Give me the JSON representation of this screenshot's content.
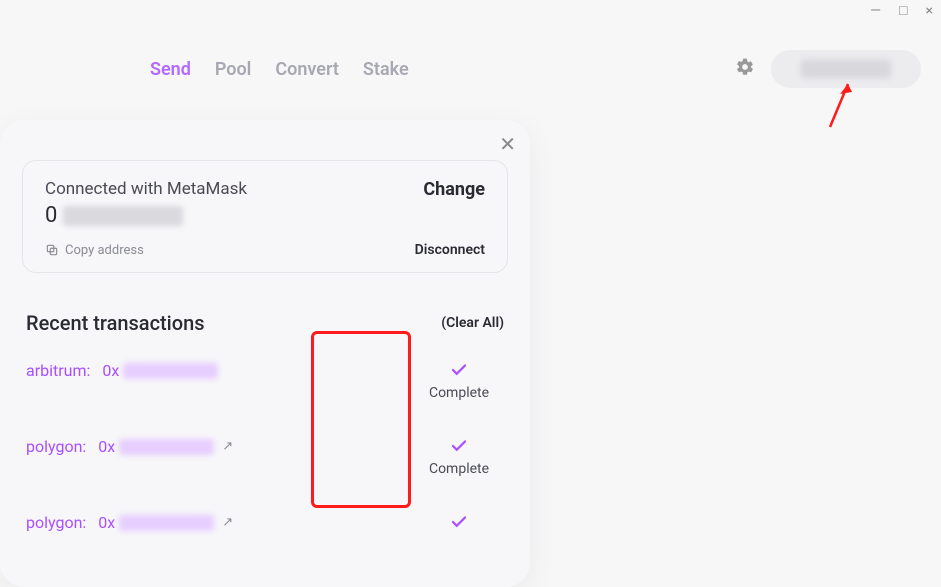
{
  "window": {
    "minimize": "—",
    "maximize": "□",
    "close": "×"
  },
  "nav": {
    "items": [
      {
        "label": "Send",
        "active": true
      },
      {
        "label": "Pool",
        "active": false
      },
      {
        "label": "Convert",
        "active": false
      },
      {
        "label": "Stake",
        "active": false
      }
    ]
  },
  "wallet": {
    "connected_label": "Connected with MetaMask",
    "address_prefix": "0",
    "change_label": "Change",
    "copy_label": "Copy address",
    "disconnect_label": "Disconnect"
  },
  "recent": {
    "title": "Recent transactions",
    "clear_label": "(Clear All)",
    "txs": [
      {
        "network": "arbitrum:",
        "hash_prefix": "0x",
        "status": "Complete"
      },
      {
        "network": "polygon:",
        "hash_prefix": "0x",
        "status": "Complete"
      },
      {
        "network": "polygon:",
        "hash_prefix": "0x",
        "status": ""
      }
    ]
  }
}
